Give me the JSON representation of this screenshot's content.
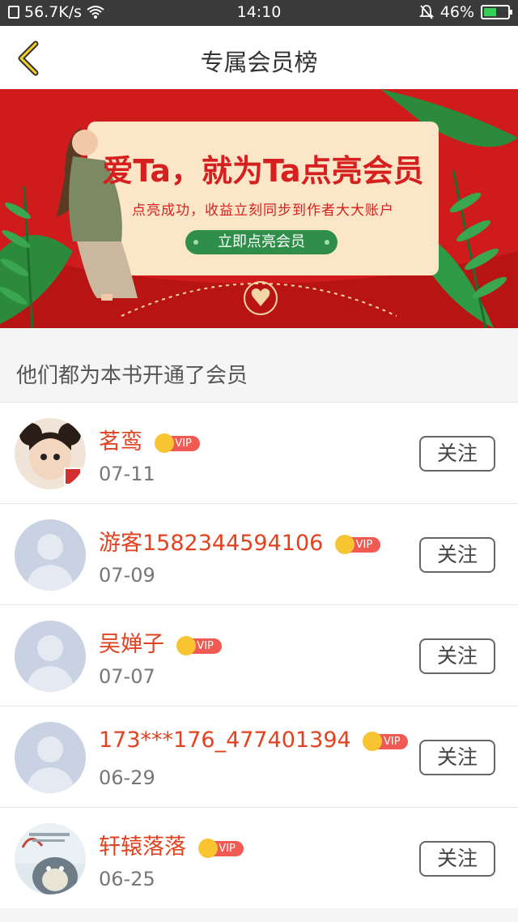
{
  "status_bar": {
    "speed": "56.7K/s",
    "time": "14:10",
    "battery": "46%"
  },
  "header": {
    "title": "专属会员榜"
  },
  "banner": {
    "headline": "爱Ta，就为Ta点亮会员",
    "subtitle": "点亮成功，收益立刻同步到作者大大账户",
    "cta": "立即点亮会员"
  },
  "section_title": "他们都为本书开通了会员",
  "vip_label": "VIP",
  "members": [
    {
      "name": "茗鸾",
      "date": "07-11",
      "follow": "关注"
    },
    {
      "name": "游客1582344594106",
      "date": "07-09",
      "follow": "关注"
    },
    {
      "name": "吴婵子",
      "date": "07-07",
      "follow": "关注"
    },
    {
      "name": "173***176_477401394",
      "date": "06-29",
      "follow": "关注"
    },
    {
      "name": "轩辕落落",
      "date": "06-25",
      "follow": "关注"
    }
  ]
}
